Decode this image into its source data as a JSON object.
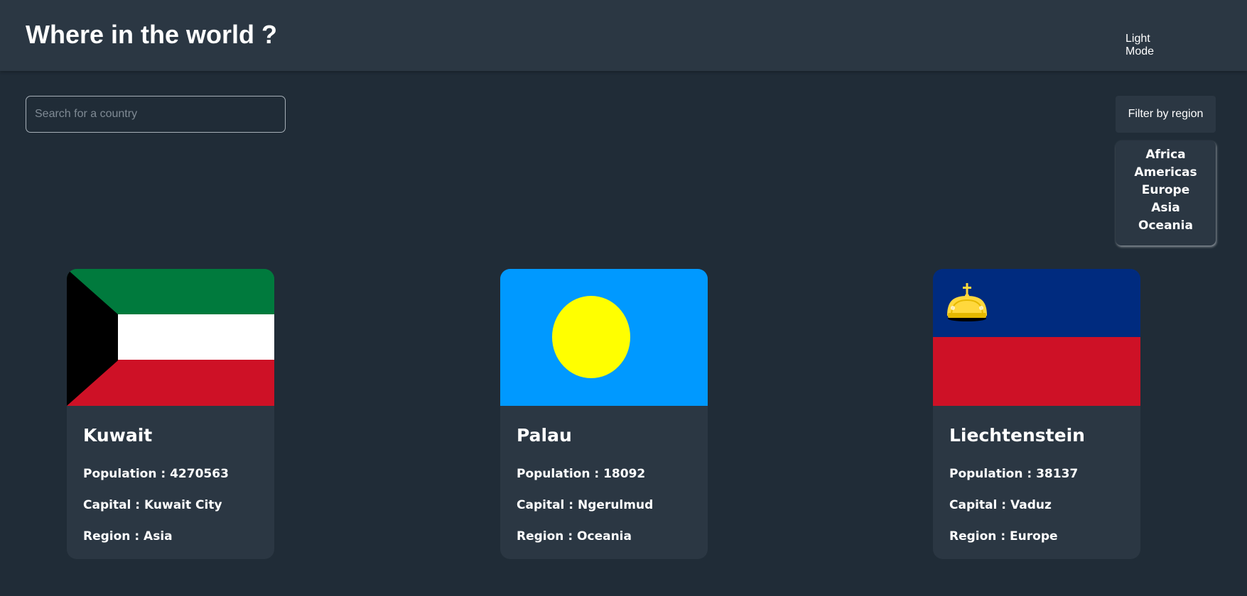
{
  "header": {
    "title": "Where in the world ?",
    "mode_toggle_label": "Light Mode"
  },
  "search": {
    "placeholder": "Search for a country",
    "value": ""
  },
  "filter": {
    "button_label": "Filter by region",
    "options": [
      "Africa",
      "Americas",
      "Europe",
      "Asia",
      "Oceania"
    ]
  },
  "labels": {
    "population": "Population",
    "capital": "Capital",
    "region": "Region",
    "separator": " : "
  },
  "countries": [
    {
      "name": "Kuwait",
      "population": "4270563",
      "capital": "Kuwait City",
      "region": "Asia",
      "flag_icon": "kuwait-flag-icon",
      "flag_colors": {
        "green": "#007a3d",
        "white": "#ffffff",
        "red": "#ce1126",
        "black": "#000000"
      }
    },
    {
      "name": "Palau",
      "population": "18092",
      "capital": "Ngerulmud",
      "region": "Oceania",
      "flag_icon": "palau-flag-icon",
      "flag_colors": {
        "blue": "#0099ff",
        "yellow": "#ffff00"
      }
    },
    {
      "name": "Liechtenstein",
      "population": "38137",
      "capital": "Vaduz",
      "region": "Europe",
      "flag_icon": "liechtenstein-flag-icon",
      "flag_colors": {
        "blue": "#002b7f",
        "red": "#ce1126",
        "gold": "#ffd83d"
      }
    }
  ],
  "theme": {
    "background": "#202c37",
    "surface": "#2b3743",
    "text": "#ffffff"
  }
}
